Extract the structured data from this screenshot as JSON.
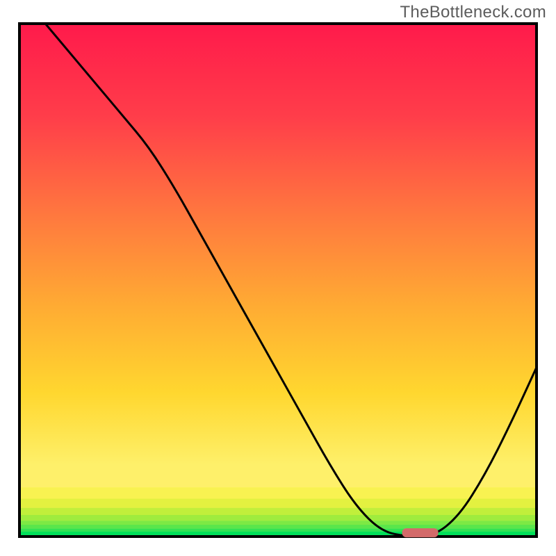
{
  "watermark": "TheBottleneck.com",
  "chart_data": {
    "type": "line",
    "title": "",
    "xlabel": "",
    "ylabel": "",
    "xlim": [
      0,
      100
    ],
    "ylim": [
      0,
      100
    ],
    "series": [
      {
        "name": "bottleneck-curve",
        "x": [
          5,
          10,
          15,
          20,
          25,
          30,
          35,
          40,
          45,
          50,
          55,
          60,
          65,
          70,
          75,
          80,
          85,
          90,
          95,
          100
        ],
        "y": [
          100,
          94,
          88,
          82,
          76,
          68,
          59,
          50,
          41,
          32,
          23,
          14,
          6,
          1,
          0,
          0,
          4,
          12,
          22,
          33
        ]
      }
    ],
    "marker": {
      "name": "optimal-range",
      "x_range": [
        74,
        81
      ],
      "y": 0.8,
      "color": "#d36a6a"
    },
    "gradient_bands": [
      {
        "y0": 0,
        "y1": 1.0,
        "color": "#00e05a"
      },
      {
        "y0": 1.0,
        "y1": 1.6,
        "color": "#33e253"
      },
      {
        "y0": 1.6,
        "y1": 2.3,
        "color": "#5ae64b"
      },
      {
        "y0": 2.3,
        "y1": 3.1,
        "color": "#7de944"
      },
      {
        "y0": 3.1,
        "y1": 4.2,
        "color": "#9fec3e"
      },
      {
        "y0": 4.2,
        "y1": 5.6,
        "color": "#c1ef3b"
      },
      {
        "y0": 5.6,
        "y1": 7.4,
        "color": "#e3f140"
      },
      {
        "y0": 7.4,
        "y1": 9.6,
        "color": "#f8f251"
      },
      {
        "y0": 9.6,
        "y1": 13,
        "color": "#fef06a"
      }
    ]
  }
}
